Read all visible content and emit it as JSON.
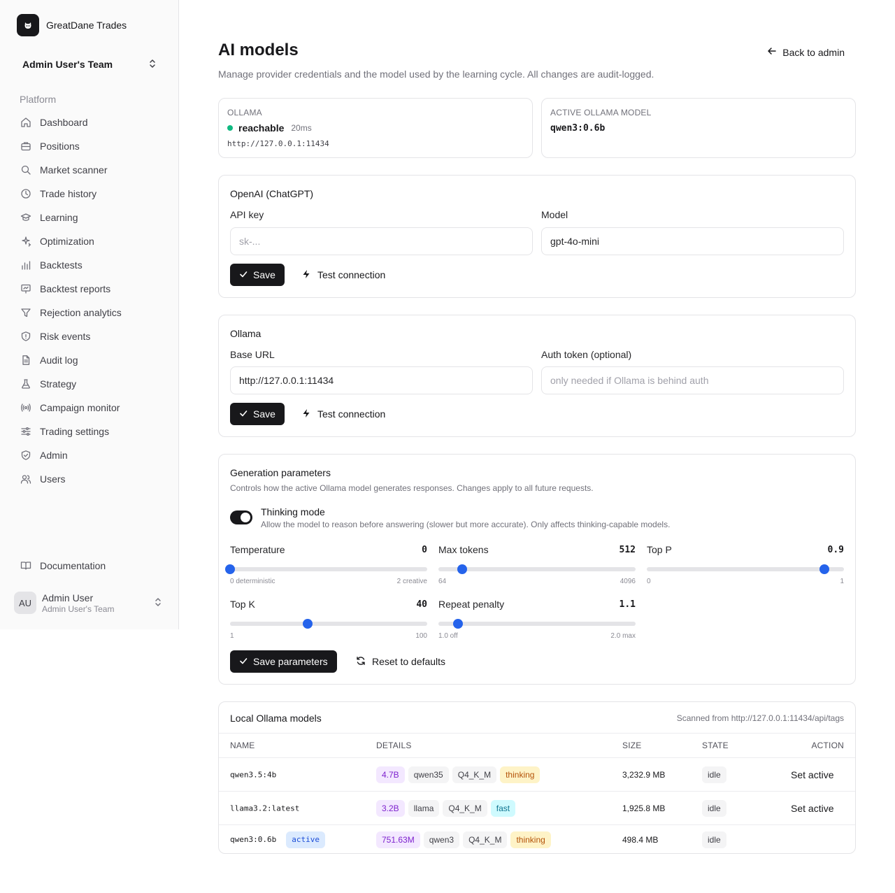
{
  "app": {
    "brand": "GreatDane Trades",
    "team": "Admin User's Team"
  },
  "sidebar": {
    "group_label": "Platform",
    "items": [
      {
        "label": "Dashboard",
        "icon": "home-icon"
      },
      {
        "label": "Positions",
        "icon": "briefcase-icon"
      },
      {
        "label": "Market scanner",
        "icon": "search-icon"
      },
      {
        "label": "Trade history",
        "icon": "clock-icon"
      },
      {
        "label": "Learning",
        "icon": "graduation-cap-icon"
      },
      {
        "label": "Optimization",
        "icon": "sparkles-icon"
      },
      {
        "label": "Backtests",
        "icon": "bar-chart-icon"
      },
      {
        "label": "Backtest reports",
        "icon": "presentation-icon"
      },
      {
        "label": "Rejection analytics",
        "icon": "filter-icon"
      },
      {
        "label": "Risk events",
        "icon": "shield-alert-icon"
      },
      {
        "label": "Audit log",
        "icon": "file-text-icon"
      },
      {
        "label": "Strategy",
        "icon": "flask-icon"
      },
      {
        "label": "Campaign monitor",
        "icon": "radio-icon"
      },
      {
        "label": "Trading settings",
        "icon": "sliders-icon"
      },
      {
        "label": "Admin",
        "icon": "shield-check-icon"
      },
      {
        "label": "Users",
        "icon": "users-icon"
      }
    ],
    "documentation": "Documentation",
    "user": {
      "initials": "AU",
      "name": "Admin User",
      "team": "Admin User's Team"
    }
  },
  "header": {
    "title": "AI models",
    "subtitle": "Manage provider credentials and the model used by the learning cycle. All changes are audit-logged.",
    "back": "Back to admin"
  },
  "status": {
    "ollama_label": "OLLAMA",
    "ollama_state": "reachable",
    "latency": "20ms",
    "ollama_url": "http://127.0.0.1:11434",
    "active_label": "ACTIVE OLLAMA MODEL",
    "active_model": "qwen3:0.6b"
  },
  "openai": {
    "title": "OpenAI (ChatGPT)",
    "api_key_label": "API key",
    "api_key_placeholder": "sk-...",
    "model_label": "Model",
    "model_value": "gpt-4o-mini",
    "save": "Save",
    "test": "Test connection"
  },
  "ollama": {
    "title": "Ollama",
    "base_url_label": "Base URL",
    "base_url_value": "http://127.0.0.1:11434",
    "auth_label": "Auth token (optional)",
    "auth_placeholder": "only needed if Ollama is behind auth",
    "save": "Save",
    "test": "Test connection"
  },
  "generation": {
    "title": "Generation parameters",
    "subtitle": "Controls how the active Ollama model generates responses. Changes apply to all future requests.",
    "thinking_label": "Thinking mode",
    "thinking_desc": "Allow the model to reason before answering (slower but more accurate). Only affects thinking-capable models.",
    "thinking_on": true,
    "sliders": [
      {
        "name": "Temperature",
        "value": "0",
        "min_label": "0 deterministic",
        "max_label": "2 creative",
        "fraction": 0.0
      },
      {
        "name": "Max tokens",
        "value": "512",
        "min_label": "64",
        "max_label": "4096",
        "fraction": 0.119
      },
      {
        "name": "Top P",
        "value": "0.9",
        "min_label": "0",
        "max_label": "1",
        "fraction": 0.9
      },
      {
        "name": "Top K",
        "value": "40",
        "min_label": "1",
        "max_label": "100",
        "fraction": 0.394
      },
      {
        "name": "Repeat penalty",
        "value": "1.1",
        "min_label": "1.0 off",
        "max_label": "2.0 max",
        "fraction": 0.1
      }
    ],
    "save": "Save parameters",
    "reset": "Reset to defaults"
  },
  "local_models": {
    "title": "Local Ollama models",
    "scanned": "Scanned from http://127.0.0.1:11434/api/tags",
    "columns": [
      "NAME",
      "DETAILS",
      "SIZE",
      "STATE",
      "ACTION"
    ],
    "rows": [
      {
        "name": "qwen3.5:4b",
        "active_badge": "",
        "chips": [
          {
            "text": "4.7B",
            "tone": "purple"
          },
          {
            "text": "qwen35",
            "tone": "gray"
          },
          {
            "text": "Q4_K_M",
            "tone": "gray"
          },
          {
            "text": "thinking",
            "tone": "amber"
          }
        ],
        "size": "3,232.9 MB",
        "state": "idle",
        "action": "Set active"
      },
      {
        "name": "llama3.2:latest",
        "active_badge": "",
        "chips": [
          {
            "text": "3.2B",
            "tone": "purple"
          },
          {
            "text": "llama",
            "tone": "gray"
          },
          {
            "text": "Q4_K_M",
            "tone": "gray"
          },
          {
            "text": "fast",
            "tone": "cyan"
          }
        ],
        "size": "1,925.8 MB",
        "state": "idle",
        "action": "Set active"
      },
      {
        "name": "qwen3:0.6b",
        "active_badge": "active",
        "chips": [
          {
            "text": "751.63M",
            "tone": "purple"
          },
          {
            "text": "qwen3",
            "tone": "gray"
          },
          {
            "text": "Q4_K_M",
            "tone": "gray"
          },
          {
            "text": "thinking",
            "tone": "amber"
          }
        ],
        "size": "498.4 MB",
        "state": "idle",
        "action": ""
      }
    ]
  }
}
